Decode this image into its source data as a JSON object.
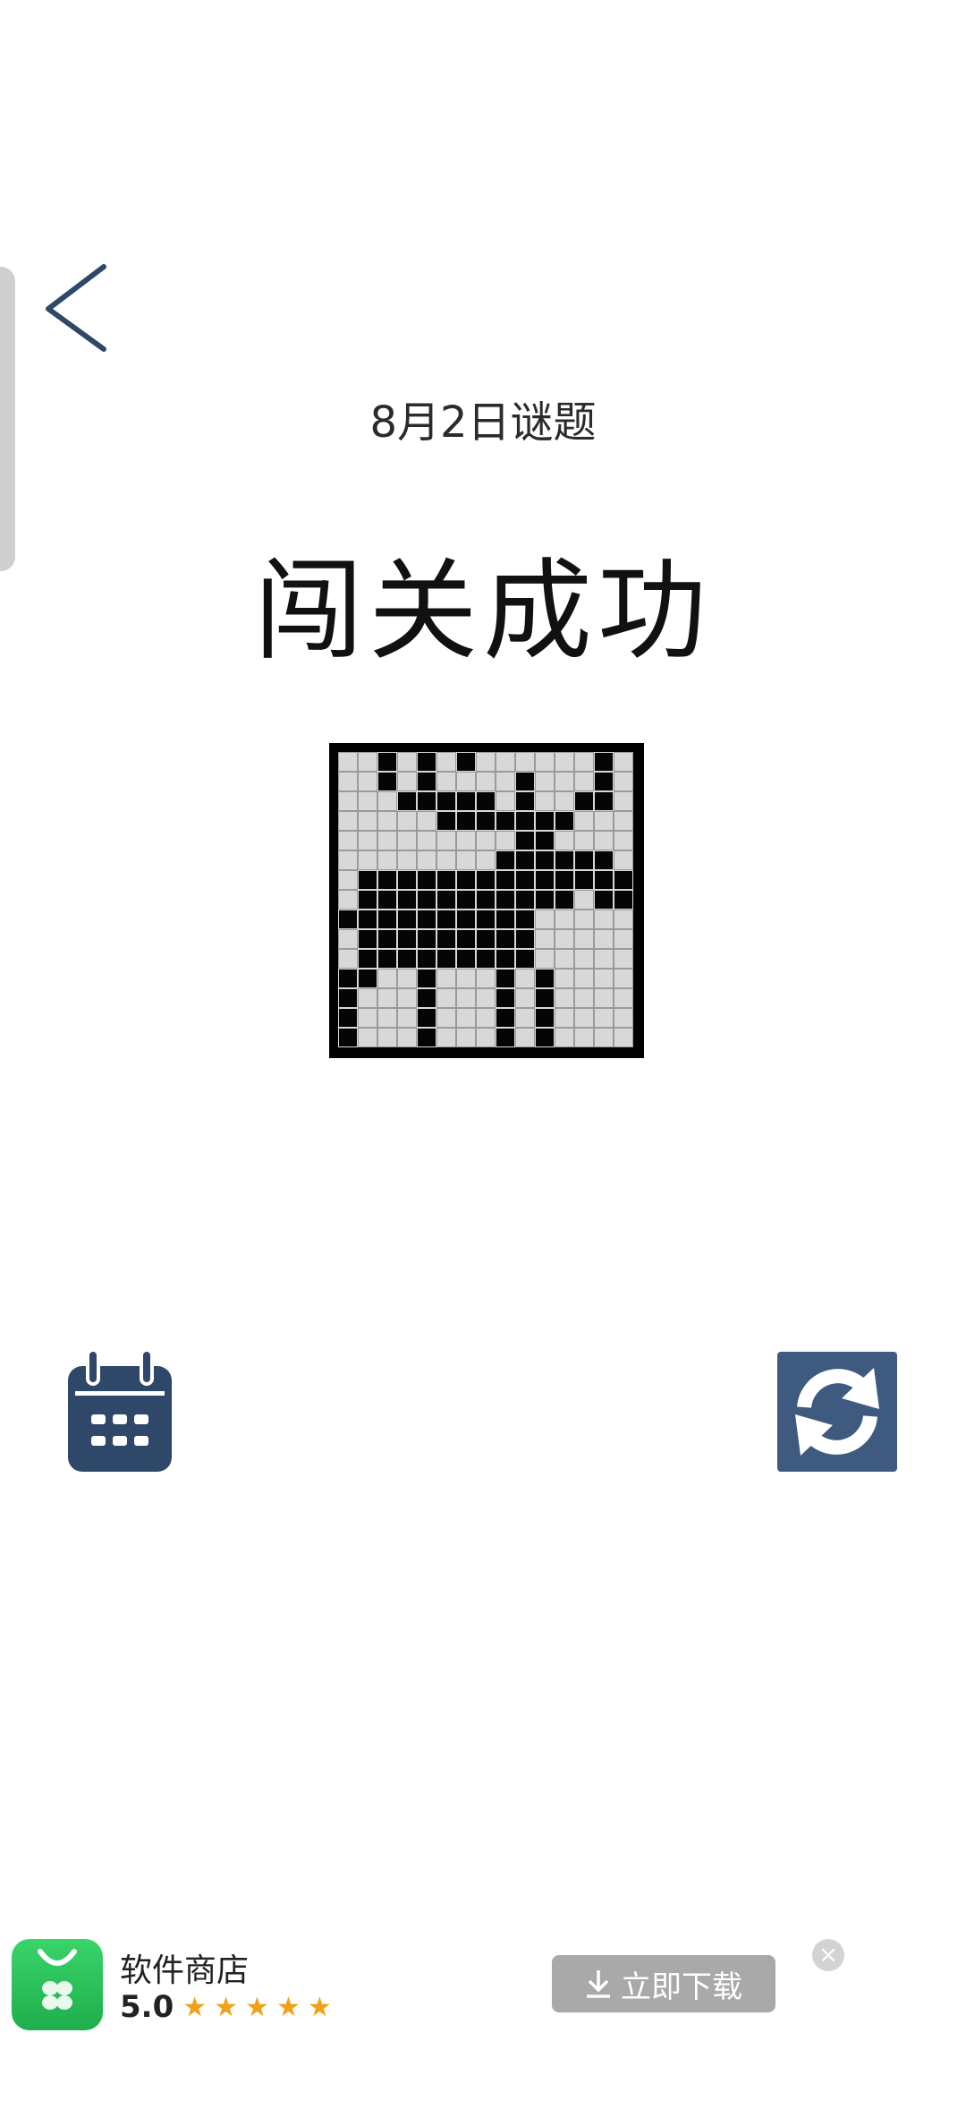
{
  "header": {
    "puzzle_date": "8月2日谜题",
    "result_title": "闯关成功"
  },
  "icons": {
    "back": "back-arrow-icon",
    "calendar": "calendar-icon",
    "refresh": "refresh-icon"
  },
  "colors": {
    "navy": "#2f4768",
    "refresh_bg": "#3f5a7f"
  },
  "solution_grid": [
    "..#.#.#......#.",
    "..#.#....#...#.",
    "...#####.#..##.",
    ".....#######...",
    ".........##....",
    "........######.",
    ".###############",
    ".###########.###",
    "##########.....",
    ".#########.....",
    ".#########.....",
    "##..#...#.#....",
    "#...#...#.#....",
    "#...#...#.#....",
    "#...#...#.#...."
  ],
  "ad": {
    "app_name": "软件商店",
    "rating": "5.0",
    "stars": 5,
    "download_label": "立即下载",
    "close_symbol": "×"
  }
}
